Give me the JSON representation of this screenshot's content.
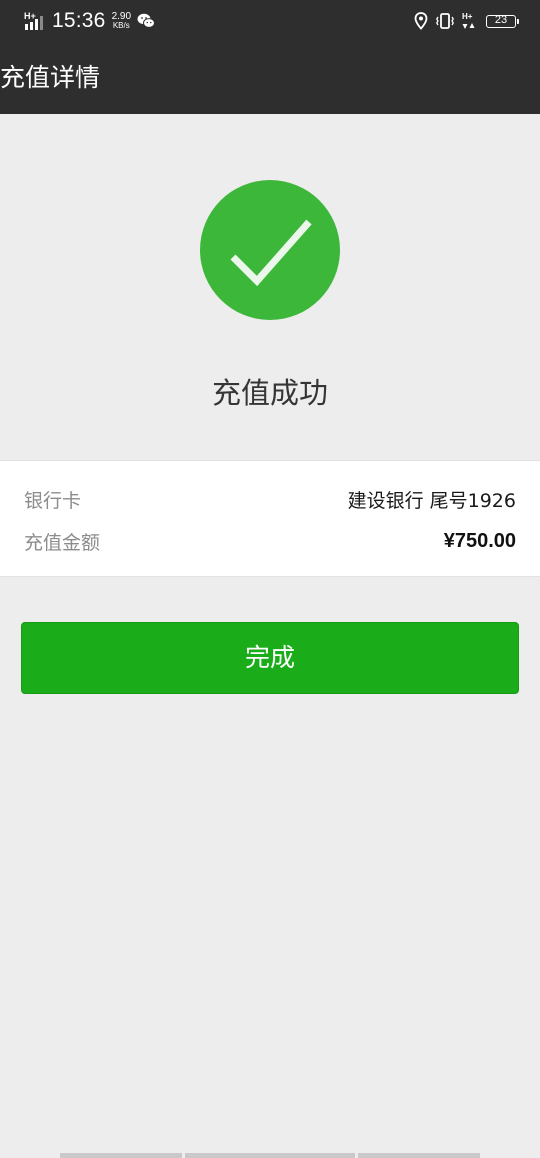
{
  "status_bar": {
    "network_left": "H+",
    "time": "15:36",
    "speed_value": "2.90",
    "speed_unit": "KB/s",
    "network_right": "H+",
    "battery": "23",
    "icons": [
      "signal-icon",
      "wechat-icon",
      "location-icon",
      "vibrate-icon",
      "data-arrows-icon",
      "battery-icon"
    ]
  },
  "header": {
    "title": "充值详情"
  },
  "result": {
    "status_text": "充值成功",
    "icon": "checkmark-icon",
    "accent_color": "#3db73a"
  },
  "details": {
    "rows": [
      {
        "label": "银行卡",
        "value": "建设银行 尾号1926"
      },
      {
        "label": "充值金额",
        "value": "¥750.00"
      }
    ]
  },
  "actions": {
    "done_label": "完成",
    "button_color": "#1aad19"
  }
}
